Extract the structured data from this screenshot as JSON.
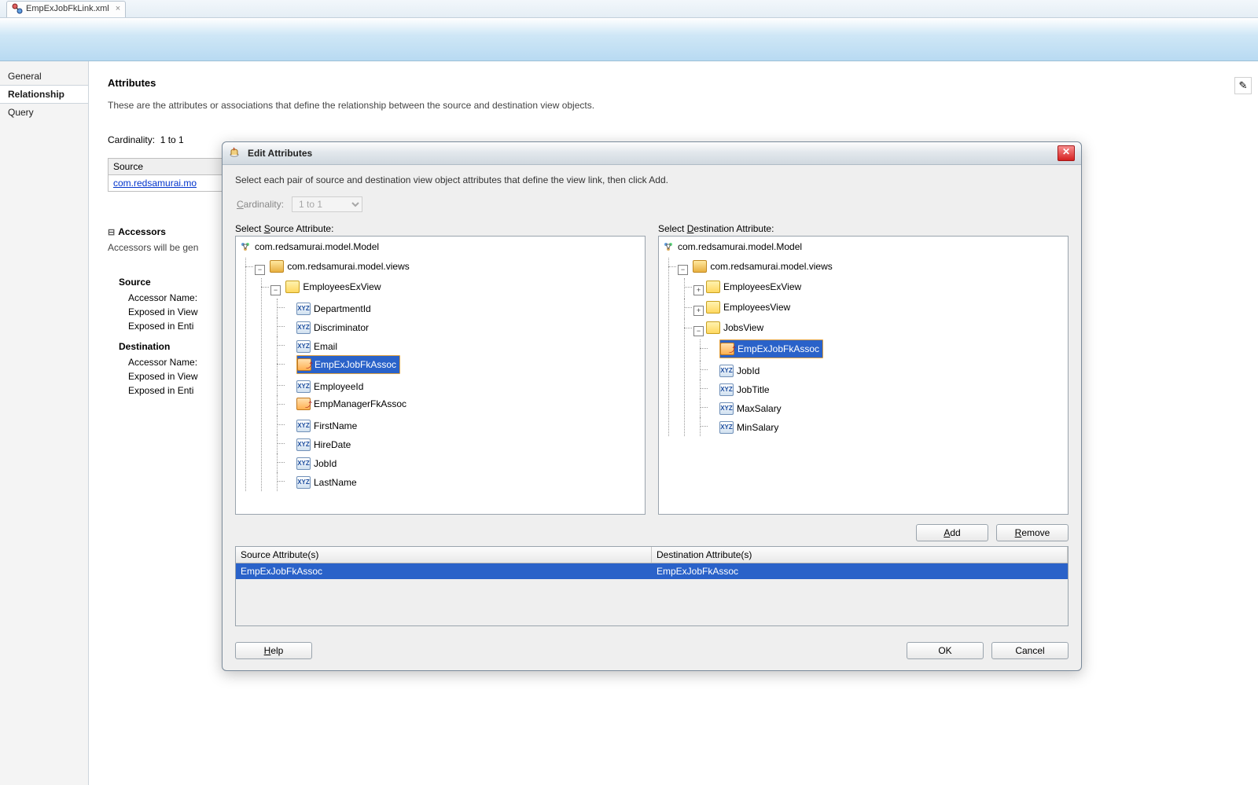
{
  "tab": {
    "filename": "EmpExJobFkLink.xml"
  },
  "side_tabs": [
    "General",
    "Relationship",
    "Query"
  ],
  "active_side_tab": "Relationship",
  "page": {
    "heading": "Attributes",
    "desc": "These are the attributes or associations that define the relationship between the source and destination view objects.",
    "cardinality_label": "Cardinality:",
    "cardinality_value": "1 to 1",
    "source_hdr": "Source",
    "source_link": "com.redsamurai.mo",
    "accessors_heading": "Accessors",
    "accessors_desc": "Accessors will be gen",
    "src_title": "Source",
    "dst_title": "Destination",
    "acc_name": "Accessor Name:",
    "exp_view": "Exposed in View",
    "exp_entity": "Exposed in Enti"
  },
  "dialog": {
    "title": "Edit Attributes",
    "instruction": "Select each pair of source and destination view object attributes that define the view link, then click Add.",
    "cardinality_label": "Cardinality:",
    "cardinality_value": "1 to 1",
    "src_cap": "Select Source Attribute:",
    "dst_cap": "Select Destination Attribute:",
    "src_tree": {
      "root": "com.redsamurai.model.Model",
      "pkg": "com.redsamurai.model.views",
      "view": "EmployeesExView",
      "attrs": [
        {
          "n": "DepartmentId",
          "t": "attr"
        },
        {
          "n": "Discriminator",
          "t": "attr"
        },
        {
          "n": "Email",
          "t": "attr"
        },
        {
          "n": "EmpExJobFkAssoc",
          "t": "assoc",
          "sel": true
        },
        {
          "n": "EmployeeId",
          "t": "attr"
        },
        {
          "n": "EmpManagerFkAssoc",
          "t": "assoc"
        },
        {
          "n": "FirstName",
          "t": "attr"
        },
        {
          "n": "HireDate",
          "t": "attr"
        },
        {
          "n": "JobId",
          "t": "attr"
        },
        {
          "n": "LastName",
          "t": "attr"
        }
      ]
    },
    "dst_tree": {
      "root": "com.redsamurai.model.Model",
      "pkg": "com.redsamurai.model.views",
      "views": [
        {
          "n": "EmployeesExView",
          "exp": false
        },
        {
          "n": "EmployeesView",
          "exp": false
        },
        {
          "n": "JobsView",
          "exp": true,
          "attrs": [
            {
              "n": "EmpExJobFkAssoc",
              "t": "assoc",
              "sel": true
            },
            {
              "n": "JobId",
              "t": "attr"
            },
            {
              "n": "JobTitle",
              "t": "attr"
            },
            {
              "n": "MaxSalary",
              "t": "attr"
            },
            {
              "n": "MinSalary",
              "t": "attr"
            }
          ]
        }
      ]
    },
    "add": "Add",
    "remove": "Remove",
    "col_src": "Source Attribute(s)",
    "col_dst": "Destination Attribute(s)",
    "row_src": "EmpExJobFkAssoc",
    "row_dst": "EmpExJobFkAssoc",
    "help": "Help",
    "ok": "OK",
    "cancel": "Cancel"
  }
}
